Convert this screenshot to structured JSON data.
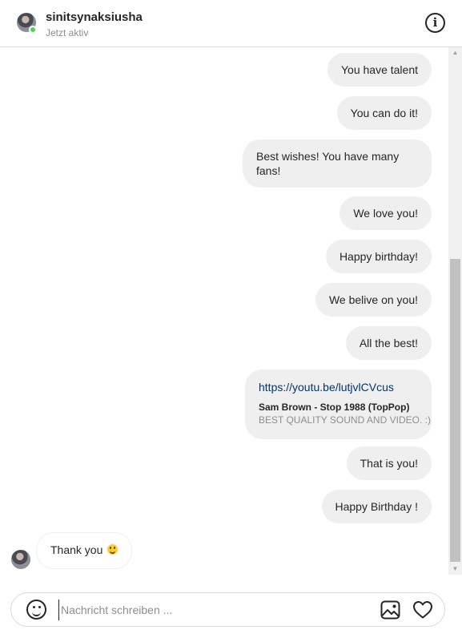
{
  "header": {
    "username": "sinitsynaksiusha",
    "status": "Jetzt aktiv",
    "info_icon": "info-icon",
    "online_color": "#4bd54b"
  },
  "messages": {
    "out_1": "You have talent",
    "out_2": "You can do it!",
    "out_3": "Best wishes! You have many fans!",
    "out_4": "We love you!",
    "out_5": "Happy birthday!",
    "out_6": "We belive on you!",
    "out_7": "All the best!",
    "link": {
      "url": "https://youtu.be/lutjvlCVcus",
      "title": "Sam Brown - Stop 1988 (TopPop)",
      "description": "BEST QUALITY SOUND AND VIDEO. :)"
    },
    "out_8": "That is you!",
    "out_9": "Happy Birthday !",
    "in_1": "Thank you",
    "in_1_emoji": "smiling-face-emoji"
  },
  "composer": {
    "placeholder": "Nachricht schreiben ...",
    "value": "",
    "emoji_icon": "smiley-icon",
    "image_icon": "image-icon",
    "heart_icon": "heart-icon"
  },
  "colors": {
    "bubble_out": "#efefef",
    "link": "#00376b",
    "secondary_text": "#8e8e8e",
    "border": "#dbdbdb"
  }
}
